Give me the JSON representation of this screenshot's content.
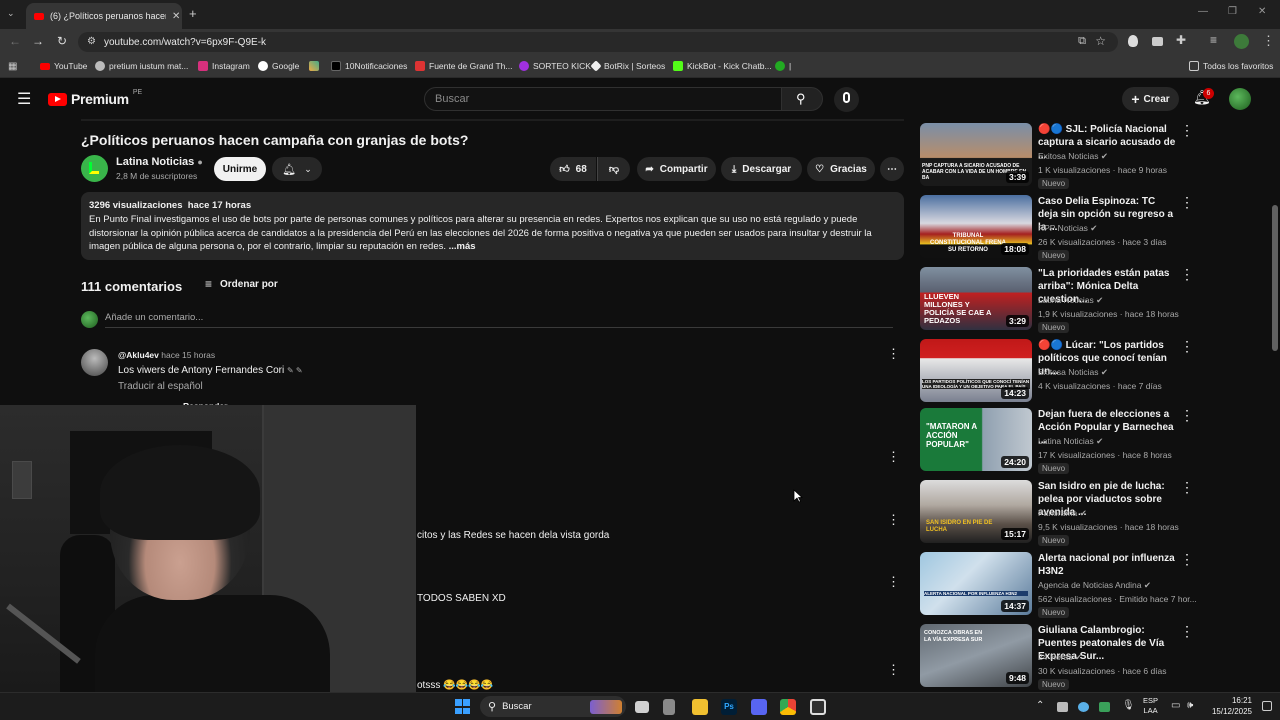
{
  "browser": {
    "tab_title": "(6) ¿Políticos peruanos hacen c...",
    "url": "youtube.com/watch?v=6px9F-Q9E-k",
    "bookmarks": [
      "YouTube",
      "pretium iustum mat...",
      "Instagram",
      "Google",
      "10Notificaciones",
      "Fuente de Grand Th...",
      "SORTEO KICK",
      "BotRix | Sorteos",
      "KickBot - Kick Chatb...",
      "|"
    ],
    "all_favorites": "Todos los favoritos"
  },
  "yt_header": {
    "logo_text": "Premium",
    "region": "PE",
    "search_placeholder": "Buscar",
    "create_label": "Crear",
    "notif_count": "6"
  },
  "video": {
    "title": "¿Políticos peruanos hacen campaña con granjas de bots?",
    "channel": "Latina Noticias",
    "subscribers": "2,8 M de suscriptores",
    "join_label": "Unirme",
    "likes": "68",
    "share_label": "Compartir",
    "download_label": "Descargar",
    "thanks_label": "Gracias",
    "views_time": "3296 visualizaciones  hace 17 horas",
    "description": "En Punto Final investigamos el uso de bots por parte de personas comunes y políticos para alterar su presencia en redes. Expertos nos explican que su uso no está regulado y puede distorsionar la opinión pública acerca de candidatos a la presidencia del Perú en las elecciones del 2026 de forma positiva o negativa ya que pueden ser usados para insultar y destruir la imagen pública de alguna persona o, por el contrario, limpiar su reputación en redes.",
    "more_label": "...más"
  },
  "comments": {
    "count_label": "111 comentarios",
    "sort_label": "Ordenar por",
    "add_placeholder": "Añade un comentario...",
    "first": {
      "author": "@Aklu4ev",
      "time": "hace 15 horas",
      "text": "Los viwers de Antony Fernandes Cori",
      "translate": "Traducir al español",
      "reply": "Responder"
    },
    "partials": [
      "citos y las Redes se hacen dela vista gorda",
      "TODOS SABEN XD",
      "otsss 😂😂😂😂"
    ]
  },
  "related": [
    {
      "title": "🔴🔵 SJL: Policía Nacional captura a sicario acusado de ...",
      "channel": "Exitosa Noticias",
      "meta": "1 K visualizaciones · hace 9 horas",
      "duration": "3:39",
      "badge": "Nuevo",
      "thumb_text": "PNP CAPTURA A SICARIO ACUSADO DE ACABAR CON LA VIDA DE UN HOMBRE EN BA"
    },
    {
      "title": "Caso Delia Espinoza: TC deja sin opción su regreso a la ...",
      "channel": "RPP Noticias",
      "meta": "26 K visualizaciones · hace 3 días",
      "duration": "18:08",
      "badge": "Nuevo",
      "thumb_text": "TRIBUNAL CONSTITUCIONAL FRENA SU RETORNO"
    },
    {
      "title": "\"La prioridades están patas arriba\": Mónica Delta cuestion...",
      "channel": "Latina Noticias",
      "meta": "1,9 K visualizaciones · hace 18 horas",
      "duration": "3:29",
      "badge": "Nuevo",
      "thumb_text": "LLUEVEN MILLONES Y POLICÍA SE CAE A PEDAZOS"
    },
    {
      "title": "🔴🔵 Lúcar: \"Los partidos políticos que conocí tenían un...",
      "channel": "Exitosa Noticias",
      "meta": "4 K visualizaciones · hace 7 días",
      "duration": "14:23",
      "badge": "",
      "thumb_text": "LOS PARTIDOS POLÍTICOS QUE CONOCÍ TENÍAN UNA IDEOLOGÍA Y UN OBJETIVO PARA EL PAÍS"
    },
    {
      "title": "Dejan fuera de elecciones a Acción Popular y Barnechea ...",
      "channel": "Latina Noticias",
      "meta": "17 K visualizaciones · hace 8 horas",
      "duration": "24:20",
      "badge": "Nuevo",
      "thumb_text": "\"MATARON A ACCIÓN POPULAR\""
    },
    {
      "title": "San Isidro en pie de lucha: pelea por viaductos sobre avenida ...",
      "channel": "Panorama",
      "meta": "9,5 K visualizaciones · hace 18 horas",
      "duration": "15:17",
      "badge": "Nuevo",
      "thumb_text": "SAN ISIDRO EN PIE DE LUCHA"
    },
    {
      "title": "Alerta nacional por influenza H3N2",
      "channel": "Agencia de Noticias Andina",
      "meta": "562 visualizaciones · Emitido hace 7 hor...",
      "duration": "14:37",
      "badge": "Nuevo",
      "thumb_text": "ALERTA NACIONAL POR INFLUENZA H3N2"
    },
    {
      "title": "Giuliana Calambrogio: Puentes peatonales de Vía Expresa Sur...",
      "channel": "24 Horas",
      "meta": "30 K visualizaciones · hace 6 días",
      "duration": "9:48",
      "badge": "Nuevo",
      "thumb_text": "CONOZCA OBRAS EN LA VÍA EXPRESA SUR"
    }
  ],
  "taskbar": {
    "search_label": "Buscar",
    "lang": "ESP",
    "lang2": "LAA",
    "time": "16:21",
    "date": "15/12/2025"
  }
}
